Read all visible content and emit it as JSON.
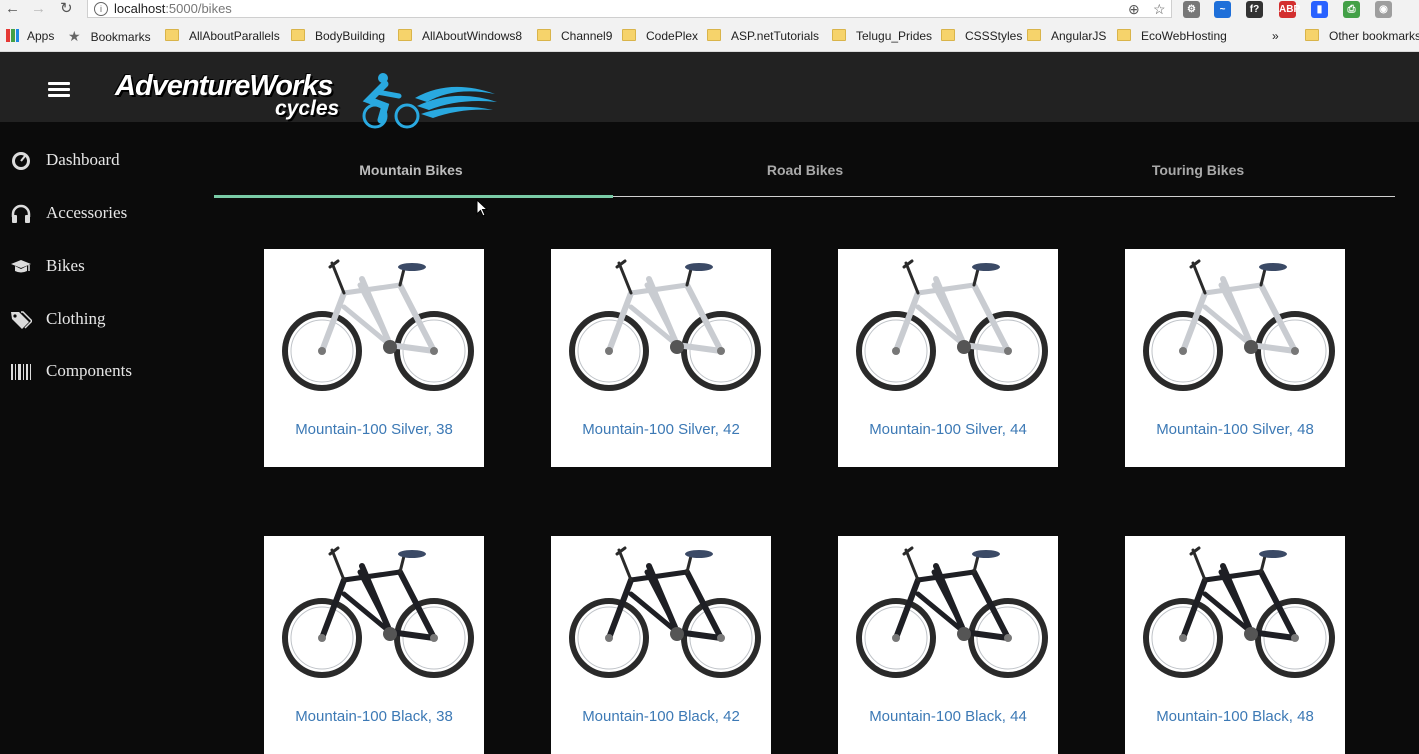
{
  "browser": {
    "url_host": "localhost",
    "url_path": ":5000/bikes",
    "bookmarks": [
      {
        "label": "Apps",
        "type": "apps"
      },
      {
        "label": "Bookmarks",
        "type": "star"
      },
      {
        "label": "AllAboutParallels",
        "type": "folder"
      },
      {
        "label": "BodyBuilding",
        "type": "folder"
      },
      {
        "label": "AllAboutWindows8",
        "type": "folder"
      },
      {
        "label": "Channel9",
        "type": "folder"
      },
      {
        "label": "CodePlex",
        "type": "folder"
      },
      {
        "label": "ASP.netTutorials",
        "type": "folder"
      },
      {
        "label": "Telugu_Prides",
        "type": "folder"
      },
      {
        "label": "CSSStyles",
        "type": "folder"
      },
      {
        "label": "AngularJS",
        "type": "folder"
      },
      {
        "label": "EcoWebHosting",
        "type": "folder"
      }
    ],
    "overflow_label": "»",
    "other_bookmarks": "Other bookmarks",
    "extensions": [
      {
        "icon": "extension-gear-icon",
        "text": "⚙",
        "color": "#777777"
      },
      {
        "icon": "extension-wave-icon",
        "text": "~",
        "color": "#1e6fd9"
      },
      {
        "icon": "extension-font-icon",
        "text": "f?",
        "color": "#333333"
      },
      {
        "icon": "adblock-icon",
        "text": "ABP",
        "color": "#d32f2f"
      },
      {
        "icon": "extension-chart-icon",
        "text": "▮",
        "color": "#2962ff"
      },
      {
        "icon": "extension-print-icon",
        "text": "⎙",
        "color": "#43a047"
      },
      {
        "icon": "extension-camera-icon",
        "text": "◉",
        "color": "#9e9e9e"
      }
    ]
  },
  "header": {
    "brand": "AdventureWorks",
    "brand_sub": "cycles",
    "logo_icon": "cyclist-logo-icon",
    "menu_icon": "hamburger-menu-icon"
  },
  "sidebar": {
    "items": [
      {
        "label": "Dashboard",
        "icon": "dashboard-icon"
      },
      {
        "label": "Accessories",
        "icon": "headphones-icon"
      },
      {
        "label": "Bikes",
        "icon": "graduation-cap-icon"
      },
      {
        "label": "Clothing",
        "icon": "tags-icon"
      },
      {
        "label": "Components",
        "icon": "barcode-icon"
      }
    ]
  },
  "tabs": {
    "active": "Mountain Bikes",
    "items": [
      {
        "label": "Mountain Bikes"
      },
      {
        "label": "Road Bikes"
      },
      {
        "label": "Touring Bikes"
      }
    ],
    "ink_color": "#79cba6"
  },
  "products": [
    {
      "name": "Mountain-100 Silver, 38",
      "frame_color": "#c9ccd1"
    },
    {
      "name": "Mountain-100 Silver, 42",
      "frame_color": "#c9ccd1"
    },
    {
      "name": "Mountain-100 Silver, 44",
      "frame_color": "#c9ccd1"
    },
    {
      "name": "Mountain-100 Silver, 48",
      "frame_color": "#c9ccd1"
    },
    {
      "name": "Mountain-100 Black, 38",
      "frame_color": "#1e1f24"
    },
    {
      "name": "Mountain-100 Black, 42",
      "frame_color": "#1e1f24"
    },
    {
      "name": "Mountain-100 Black, 44",
      "frame_color": "#1e1f24"
    },
    {
      "name": "Mountain-100 Black, 48",
      "frame_color": "#1e1f24"
    }
  ],
  "colors": {
    "header_bg": "#222222",
    "page_bg": "#0b0b0b",
    "product_link": "#3c79b5"
  }
}
